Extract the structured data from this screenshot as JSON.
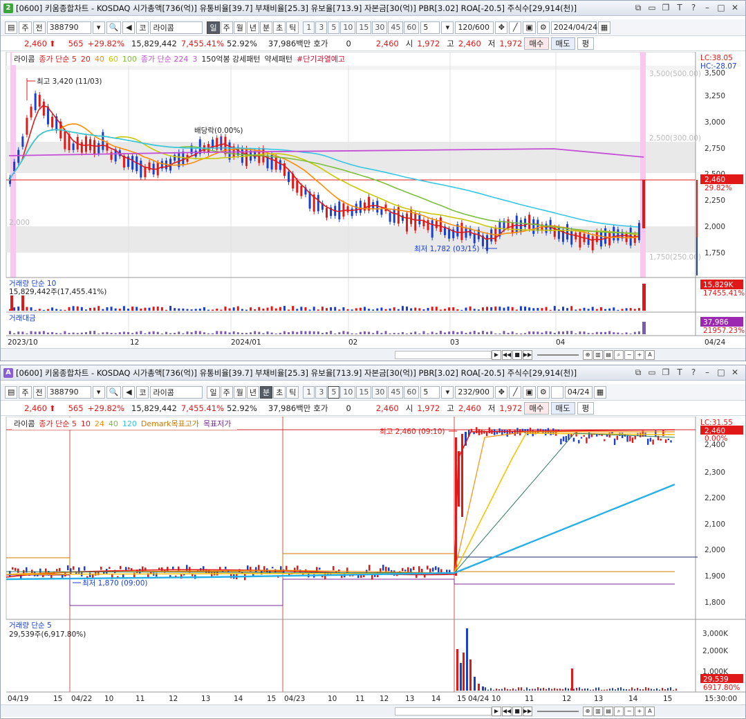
{
  "top": {
    "window_no": "2",
    "title": "[0600] 키움종합차트 - KOSDAQ 시가총액[736(억)] 유통비율[39.7] 부채비율[25.3] 유보율[713.9] 자본금[30(억)] PBR[3.02] ROA[-20.5] 주식수[29,914(천)]",
    "toolbar": {
      "kind": "주",
      "scope": "전",
      "code": "388790",
      "name": "라이콤",
      "periods": [
        "일",
        "주",
        "월",
        "년",
        "분",
        "초",
        "틱"
      ],
      "selected_period": "일",
      "nums": [
        "1",
        "3",
        "5",
        "10",
        "15",
        "30",
        "45",
        "60"
      ],
      "n": "5",
      "count": "120/600",
      "date": "2024/04/24"
    },
    "quote": {
      "price": "2,460",
      "change": "565",
      "rate": "+29.82%",
      "volume": "15,829,442",
      "vol_rate": "7,455.41%",
      "turnover": "52.92%",
      "amount": "37,986백만",
      "hoga_label": "호가",
      "hoga": "0",
      "cur": "2,460",
      "open_label": "시",
      "open": "1,972",
      "high_label": "고",
      "high": "2,460",
      "low_label": "저",
      "low": "1,972",
      "sell": "매수",
      "buy": "매도",
      "eval": "평"
    },
    "legend": [
      "라이콤",
      "종가 단순 5",
      "20",
      "40",
      "60",
      "100",
      "종가 단순 224",
      "3",
      "150억봉 강세패턴",
      "약세패턴",
      "#단기과열예고"
    ],
    "lc": "LC:38.05",
    "hc": "HC:-28.07",
    "yticks": [
      "3,500",
      "3,250",
      "3,000",
      "2,750",
      "2,500",
      "2,250",
      "2,000",
      "1,750"
    ],
    "price_box": "2,460",
    "pct_box": "29.82%",
    "high_note": "최고 3,420 (11/03)",
    "low_note": "최저 1,782 (03/15)",
    "dividend_note": "배당락(0.00%)",
    "bands": [
      "3,500(500.00)",
      "2,500(300.00)",
      "1,750(250.00)",
      "2,000"
    ],
    "vol_legend": "거래량 단순 10",
    "vol_value": "15,829,442주(17,455.41%)",
    "vol_box": "15,829K",
    "vol_box2": "17455.41%",
    "amt_legend": "거래대금",
    "amt_box": "37,986",
    "amt_box2": "21957.23%",
    "xlabels": [
      "2023/10",
      "12",
      "2024/01",
      "02",
      "03",
      "04",
      "04/24"
    ]
  },
  "bottom": {
    "window_no": "A",
    "title": "[0600] 키움종합차트 - KOSDAQ 시가총액[736(억)] 유통비율[39.7] 부채비율[25.3] 유보율[713.9] 자본금[30(억)] PBR[3.02] ROA[-20.5] 주식수[29,914(천)]",
    "toolbar": {
      "kind": "주",
      "scope": "전",
      "code": "388790",
      "name": "라이콤",
      "periods": [
        "일",
        "주",
        "월",
        "년",
        "분",
        "초",
        "틱"
      ],
      "selected_period": "분",
      "nums": [
        "1",
        "3",
        "5",
        "10",
        "15",
        "30",
        "45",
        "60"
      ],
      "selected_num": "5",
      "n": "5",
      "count": "232/900",
      "date": "04/24"
    },
    "legend": [
      "라이콤",
      "종가 단순 5",
      "10",
      "24",
      "40",
      "120",
      "Demark목표고가",
      "목표저가"
    ],
    "lc": "LC:31.55",
    "yticks": [
      "2,400",
      "2,300",
      "2,200",
      "2,100",
      "2,000",
      "1,900",
      "1,800"
    ],
    "price_box": "2,460",
    "pct_box": "0.00%",
    "high_note": "최고 2,460 (09:10)",
    "low_note": "최저 1,870 (09:00)",
    "vol_legend": "거래량 단순 5",
    "vol_value": "29,539주(6,917.80%)",
    "vol_ticks": [
      "3,000K",
      "2,000K",
      "1,000K"
    ],
    "vol_box": "29,539",
    "vol_box2": "6917.80%",
    "xlabels": [
      "04/19",
      "15",
      "04/22",
      "10",
      "11",
      "12",
      "13",
      "14",
      "15",
      "04/23",
      "10",
      "11",
      "12",
      "13",
      "14",
      "15",
      "04/24",
      "10",
      "11",
      "12",
      "13",
      "14",
      "15",
      "15:30:00"
    ]
  },
  "colors": {
    "up": "#e01818",
    "down": "#1a3fd0",
    "ma5": "#e01818",
    "ma20": "#ff8c00",
    "ma40": "#c8c800",
    "ma60": "#7cbf3a",
    "ma100": "#33c6e6",
    "ma224": "#c44ed6"
  }
}
